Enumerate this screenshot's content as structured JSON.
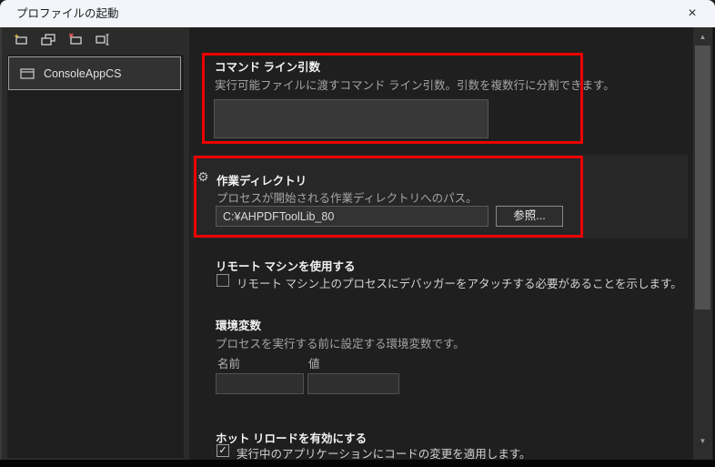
{
  "window": {
    "title": "プロファイルの起動"
  },
  "icons": {
    "close": "×",
    "gear": "⚙",
    "check": "✓",
    "scroll_up": "▲",
    "scroll_down": "▼"
  },
  "colors": {
    "annotation_red": "#ee0000",
    "titlebar_bg": "#f3f5fa",
    "body_bg": "#1f1f1f",
    "sidebar_bg": "#2b2b2b",
    "highlight_row_bg": "#272727"
  },
  "sidebar": {
    "toolbar": [
      {
        "name": "new-profile-icon"
      },
      {
        "name": "duplicate-profile-icon"
      },
      {
        "name": "delete-profile-icon"
      },
      {
        "name": "rename-profile-icon"
      }
    ],
    "profiles": [
      {
        "label": "ConsoleAppCS",
        "selected": true
      }
    ]
  },
  "sections": {
    "command_args": {
      "title": "コマンド ライン引数",
      "description": "実行可能ファイルに渡すコマンド ライン引数。引数を複数行に分割できます。",
      "value": ""
    },
    "working_dir": {
      "title": "作業ディレクトリ",
      "description": "プロセスが開始される作業ディレクトリへのパス。",
      "value": "C:¥AHPDFToolLib_80",
      "browse_label": "参照..."
    },
    "remote_machine": {
      "title": "リモート マシンを使用する",
      "checkbox_label": "リモート マシン上のプロセスにデバッガーをアタッチする必要があることを示します。",
      "checked": false
    },
    "env_vars": {
      "title": "環境変数",
      "description": "プロセスを実行する前に設定する環境変数です。",
      "name_header": "名前",
      "value_header": "値",
      "name_value": "",
      "value_value": ""
    },
    "hot_reload": {
      "title": "ホット リロードを有効にする",
      "checkbox_label": "実行中のアプリケーションにコードの変更を適用します。",
      "checked": true
    }
  }
}
